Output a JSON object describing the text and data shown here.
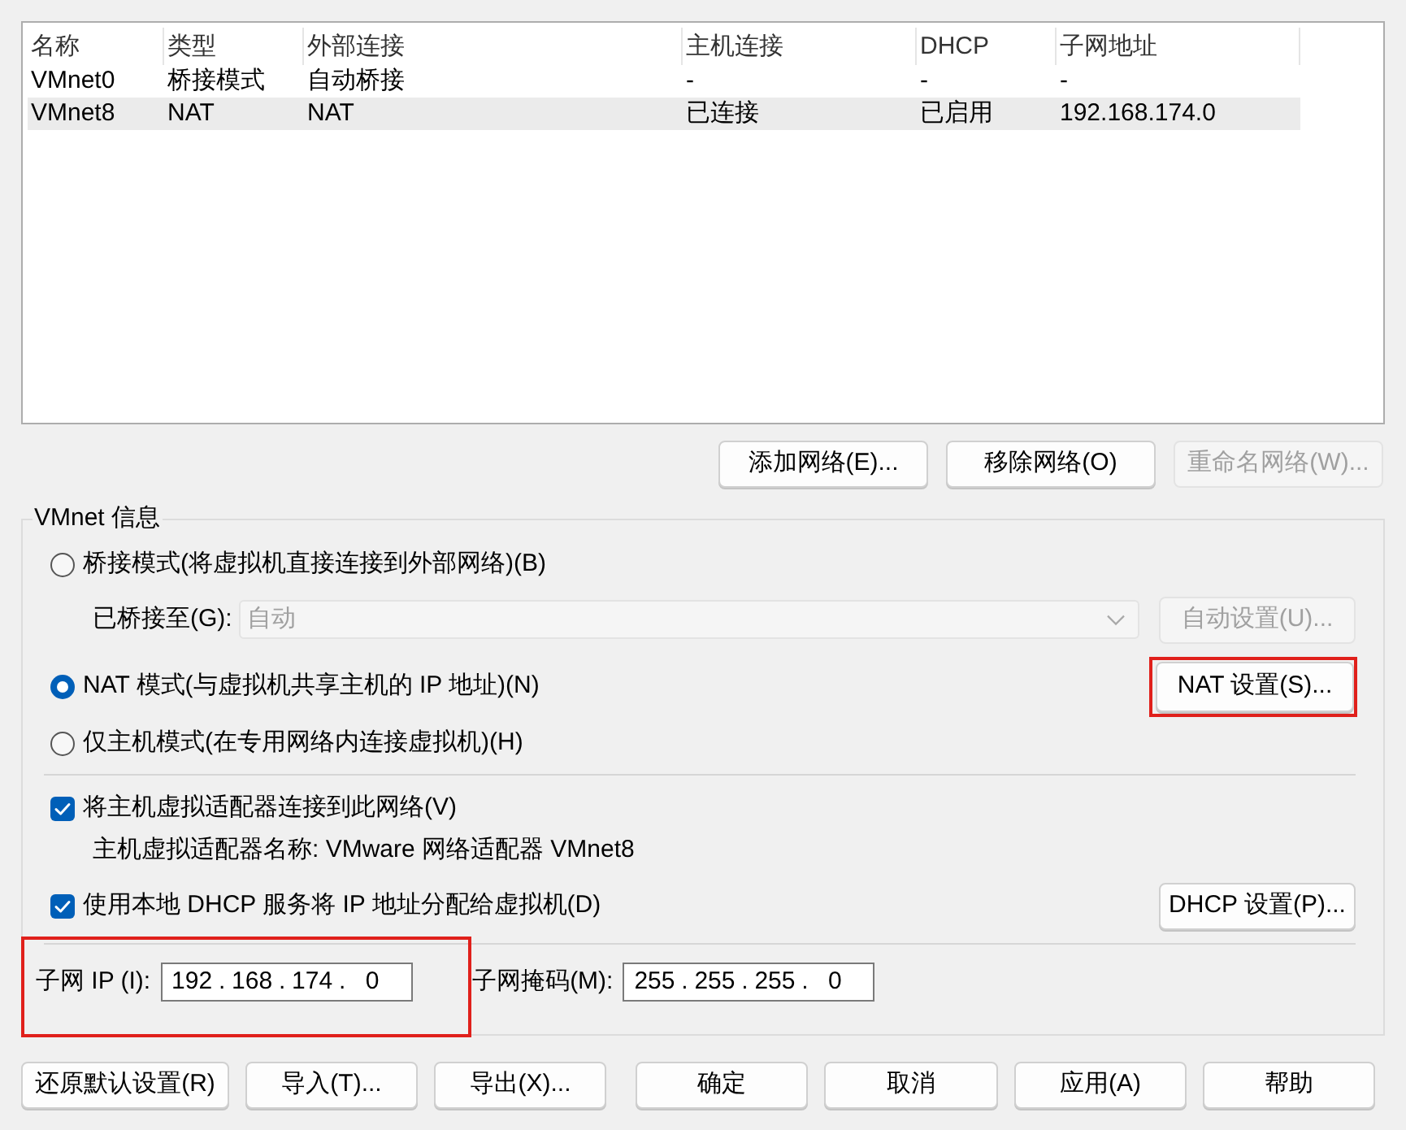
{
  "network_table": {
    "columns": [
      "名称",
      "类型",
      "外部连接",
      "主机连接",
      "DHCP",
      "子网地址"
    ],
    "rows": [
      {
        "cells": [
          "VMnet0",
          "桥接模式",
          "自动桥接",
          "-",
          "-",
          "-"
        ],
        "selected": false
      },
      {
        "cells": [
          "VMnet8",
          "NAT",
          "NAT",
          "已连接",
          "已启用",
          "192.168.174.0"
        ],
        "selected": true
      }
    ]
  },
  "network_buttons": [
    {
      "label": "添加网络(E)...",
      "disabled": false
    },
    {
      "label": "移除网络(O)",
      "disabled": false
    },
    {
      "label": "重命名网络(W)...",
      "disabled": true
    }
  ],
  "vmnet_info": {
    "title": "VMnet 信息",
    "modes": [
      {
        "label": "桥接模式(将虚拟机直接连接到外部网络)(B)",
        "selected": false
      },
      {
        "label": "NAT 模式(与虚拟机共享主机的 IP 地址)(N)",
        "selected": true
      },
      {
        "label": "仅主机模式(在专用网络内连接虚拟机)(H)",
        "selected": false
      }
    ],
    "bridged_to": {
      "label": "已桥接至(G):",
      "value": "自动",
      "disabled": true
    },
    "auto_settings_button": {
      "label": "自动设置(U)...",
      "disabled": true
    },
    "nat_settings_button": {
      "label": "NAT 设置(S)...",
      "disabled": false,
      "highlighted": true
    },
    "connect_host_adapter": {
      "label": "将主机虚拟适配器连接到此网络(V)",
      "checked": true
    },
    "adapter_name": "主机虚拟适配器名称: VMware 网络适配器 VMnet8",
    "use_dhcp": {
      "label": "使用本地 DHCP 服务将 IP 地址分配给虚拟机(D)",
      "checked": true
    },
    "dhcp_settings_button": {
      "label": "DHCP 设置(P)...",
      "disabled": false
    },
    "subnet_ip": {
      "label": "子网 IP (I):",
      "octets": [
        "192",
        "168",
        "174",
        "0"
      ],
      "separator": ".",
      "highlighted": true
    },
    "subnet_mask": {
      "label": "子网掩码(M):",
      "octets": [
        "255",
        "255",
        "255",
        "0"
      ],
      "separator": "."
    }
  },
  "dialog_buttons": [
    "还原默认设置(R)",
    "导入(T)...",
    "导出(X)...",
    "确定",
    "取消",
    "应用(A)",
    "帮助"
  ]
}
